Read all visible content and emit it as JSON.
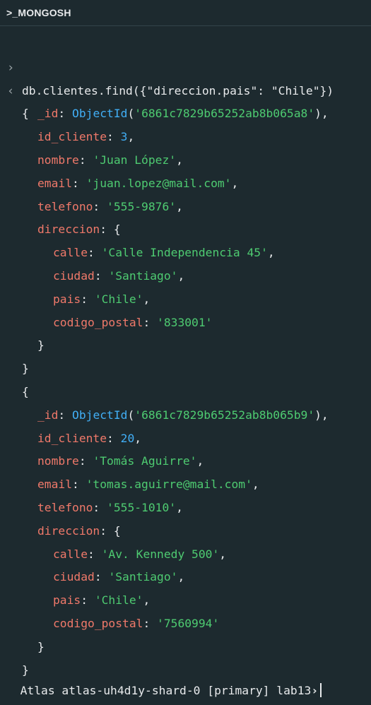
{
  "app": {
    "title": ">_MONGOSH"
  },
  "command": {
    "prompt_glyph": "›",
    "text": "db.clientes.find({\"direccion.pais\": \"Chile\"})"
  },
  "result_glyph": "‹",
  "documents": [
    {
      "_id": "'6861c7829b65252ab8b065a8'",
      "id_cliente": "3",
      "nombre": "'Juan López'",
      "email": "'juan.lopez@mail.com'",
      "telefono": "'555-9876'",
      "direccion": {
        "calle": "'Calle Independencia 45'",
        "ciudad": "'Santiago'",
        "pais": "'Chile'",
        "codigo_postal": "'833001'"
      }
    },
    {
      "_id": "'6861c7829b65252ab8b065b9'",
      "id_cliente": "20",
      "nombre": "'Tomás Aguirre'",
      "email": "'tomas.aguirre@mail.com'",
      "telefono": "'555-1010'",
      "direccion": {
        "calle": "'Av. Kennedy 500'",
        "ciudad": "'Santiago'",
        "pais": "'Chile'",
        "codigo_postal": "'7560994'"
      }
    }
  ],
  "labels": {
    "_id": "_id",
    "objectid": "ObjectId",
    "id_cliente": "id_cliente",
    "nombre": "nombre",
    "email": "email",
    "telefono": "telefono",
    "direccion": "direccion",
    "calle": "calle",
    "ciudad": "ciudad",
    "pais": "pais",
    "codigo_postal": "codigo_postal"
  },
  "footer": {
    "prompt": "Atlas atlas-uh4d1y-shard-0 [primary] lab13",
    "prompt_glyph": "›"
  },
  "colors": {
    "background": "#1d2a2f",
    "key": "#f0796a",
    "string": "#4ecb71",
    "number": "#41aef5"
  }
}
